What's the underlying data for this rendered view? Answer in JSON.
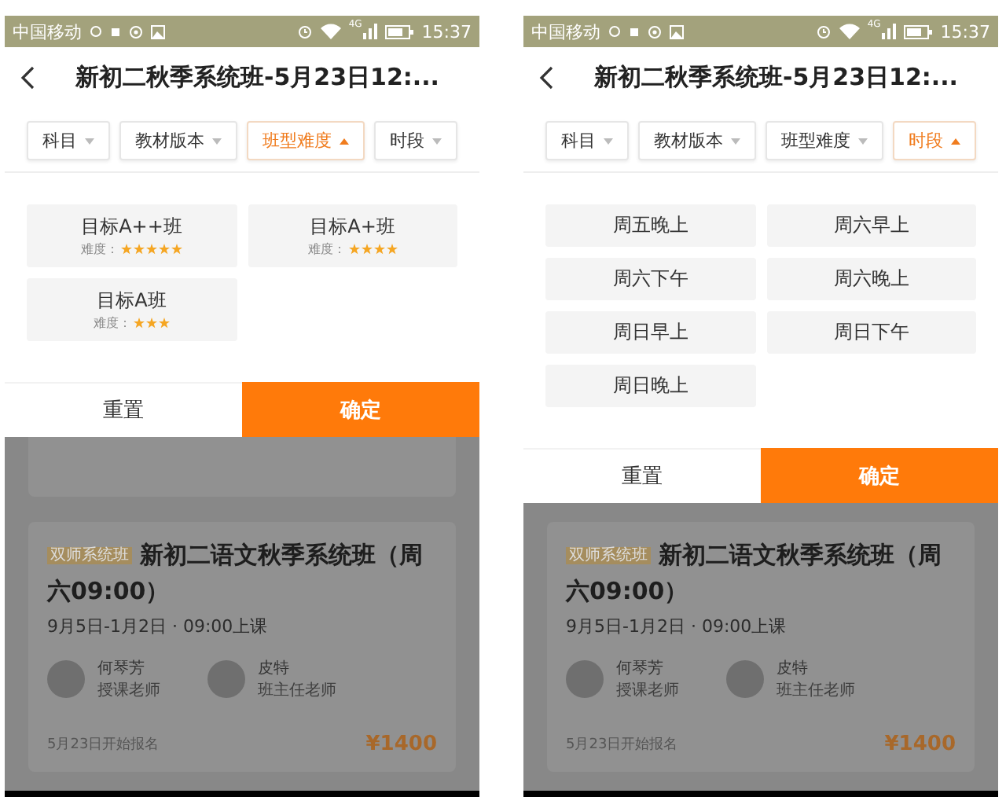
{
  "phones": [
    {
      "status_bar": {
        "carrier": "中国移动",
        "network": "4G",
        "time": "15:37"
      },
      "header": {
        "title": "新初二秋季系统班-5月23日12:..."
      },
      "filters": [
        {
          "label": "科目",
          "selected": false
        },
        {
          "label": "教材版本",
          "selected": false
        },
        {
          "label": "班型难度",
          "selected": true
        },
        {
          "label": "时段",
          "selected": false
        }
      ],
      "options": [
        {
          "kind": "difficulty",
          "label": "目标A++班",
          "difficulty_label": "难度：",
          "stars": 5
        },
        {
          "kind": "difficulty",
          "label": "目标A+班",
          "difficulty_label": "难度：",
          "stars": 4
        },
        {
          "kind": "difficulty",
          "label": "目标A班",
          "difficulty_label": "难度：",
          "stars": 3
        }
      ],
      "buttons": {
        "reset": "重置",
        "confirm": "确定"
      },
      "cards": [
        {
          "kind": "stub"
        },
        {
          "kind": "full",
          "badge": "双师系统班",
          "title": "新初二语文秋季系统班（周六09:00）",
          "schedule": "9月5日-1月2日 · 09:00上课",
          "teachers": [
            {
              "name": "何琴芳",
              "role": "授课老师"
            },
            {
              "name": "皮特",
              "role": "班主任老师"
            }
          ],
          "enroll": "5月23日开始报名",
          "price": "¥1400"
        }
      ]
    },
    {
      "status_bar": {
        "carrier": "中国移动",
        "network": "4G",
        "time": "15:37"
      },
      "header": {
        "title": "新初二秋季系统班-5月23日12:..."
      },
      "filters": [
        {
          "label": "科目",
          "selected": false
        },
        {
          "label": "教材版本",
          "selected": false
        },
        {
          "label": "班型难度",
          "selected": false
        },
        {
          "label": "时段",
          "selected": true
        }
      ],
      "options": [
        {
          "kind": "plain",
          "label": "周五晚上"
        },
        {
          "kind": "plain",
          "label": "周六早上"
        },
        {
          "kind": "plain",
          "label": "周六下午"
        },
        {
          "kind": "plain",
          "label": "周六晚上"
        },
        {
          "kind": "plain",
          "label": "周日早上"
        },
        {
          "kind": "plain",
          "label": "周日下午"
        },
        {
          "kind": "plain",
          "label": "周日晚上"
        }
      ],
      "buttons": {
        "reset": "重置",
        "confirm": "确定"
      },
      "cards": [
        {
          "kind": "full",
          "badge": "双师系统班",
          "title": "新初二语文秋季系统班（周六09:00）",
          "schedule": "9月5日-1月2日 · 09:00上课",
          "teachers": [
            {
              "name": "何琴芳",
              "role": "授课老师"
            },
            {
              "name": "皮特",
              "role": "班主任老师"
            }
          ],
          "enroll": "5月23日开始报名",
          "price": "¥1400"
        }
      ]
    }
  ]
}
